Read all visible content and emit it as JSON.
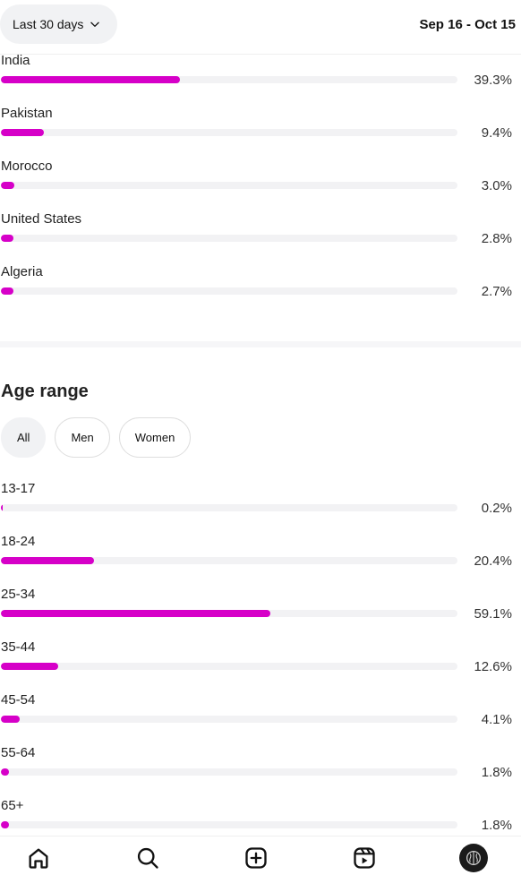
{
  "header": {
    "range_label": "Last 30 days",
    "date_range": "Sep 16 - Oct 15"
  },
  "countries": {
    "items": [
      {
        "label": "India",
        "value": 39.3,
        "percent": "39.3%"
      },
      {
        "label": "Pakistan",
        "value": 9.4,
        "percent": "9.4%"
      },
      {
        "label": "Morocco",
        "value": 3.0,
        "percent": "3.0%"
      },
      {
        "label": "United States",
        "value": 2.8,
        "percent": "2.8%"
      },
      {
        "label": "Algeria",
        "value": 2.7,
        "percent": "2.7%"
      }
    ]
  },
  "age": {
    "title": "Age range",
    "filters": [
      "All",
      "Men",
      "Women"
    ],
    "active_filter": "All",
    "items": [
      {
        "label": "13-17",
        "value": 0.2,
        "percent": "0.2%"
      },
      {
        "label": "18-24",
        "value": 20.4,
        "percent": "20.4%"
      },
      {
        "label": "25-34",
        "value": 59.1,
        "percent": "59.1%"
      },
      {
        "label": "35-44",
        "value": 12.6,
        "percent": "12.6%"
      },
      {
        "label": "45-54",
        "value": 4.1,
        "percent": "4.1%"
      },
      {
        "label": "55-64",
        "value": 1.8,
        "percent": "1.8%"
      },
      {
        "label": "65+",
        "value": 1.8,
        "percent": "1.8%"
      }
    ]
  },
  "nav": {
    "items": [
      "home-icon",
      "search-icon",
      "create-icon",
      "reels-icon",
      "profile-avatar"
    ]
  },
  "colors": {
    "accent": "#d600c8",
    "track": "#f2f2f4"
  }
}
